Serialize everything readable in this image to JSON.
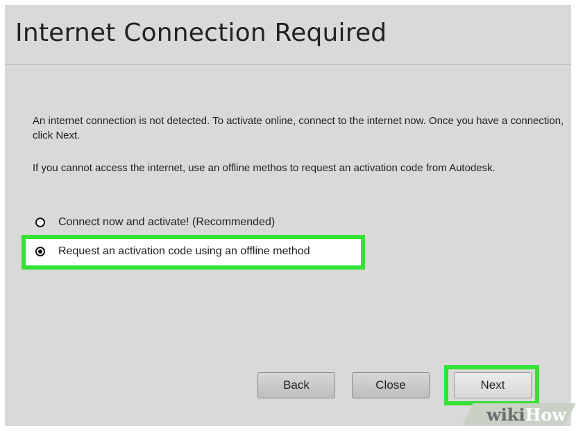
{
  "dialog": {
    "title": "Internet Connection Required",
    "paragraph1": "An internet connection is not detected. To activate online, connect to the internet now. Once you have a connection, click Next.",
    "paragraph2": "If you cannot access the internet, use an offline methos to request an activation code from Autodesk."
  },
  "options": [
    {
      "label": "Connect now and activate! (Recommended)",
      "checked": false
    },
    {
      "label": "Request an activation code using an offline method",
      "checked": true
    }
  ],
  "buttons": {
    "back": "Back",
    "close": "Close",
    "next": "Next"
  },
  "watermark": {
    "part1": "wiki",
    "part2": "How"
  },
  "colors": {
    "dialog_background": "#d9d9d9",
    "highlight": "#33e233"
  },
  "icons": {
    "radio_unchecked": "radio-unchecked-icon",
    "radio_checked": "radio-checked-icon"
  }
}
